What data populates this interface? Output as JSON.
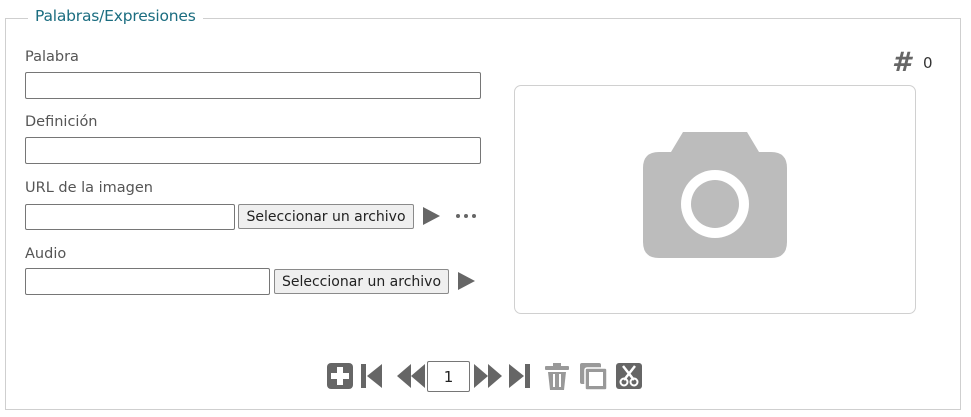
{
  "fieldset": {
    "legend": "Palabras/Expresiones"
  },
  "form": {
    "word_label": "Palabra",
    "word_value": "",
    "definition_label": "Definición",
    "definition_value": "",
    "image_url_label": "URL de la imagen",
    "image_url_value": "",
    "image_select_button": "Seleccionar un archivo",
    "audio_label": "Audio",
    "audio_value": "",
    "audio_select_button": "Seleccionar un archivo"
  },
  "counter": {
    "symbol": "#",
    "value": "0"
  },
  "image_preview": {
    "icon": "camera-icon",
    "color": "#bcbcbc"
  },
  "pager": {
    "current_page": "1",
    "icons": [
      "add-icon",
      "first-page-icon",
      "previous-page-icon",
      "next-page-icon",
      "last-page-icon",
      "delete-icon",
      "copy-icon",
      "cut-icon"
    ]
  },
  "colors": {
    "legend": "#1b6d80",
    "icon": "#666666"
  }
}
